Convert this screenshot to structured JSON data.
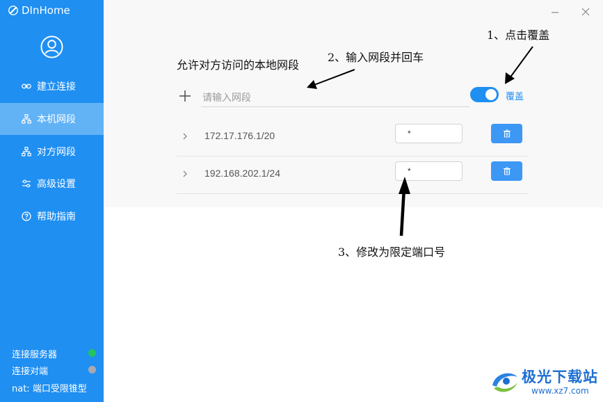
{
  "app": {
    "title": "DInHome"
  },
  "sidebar": {
    "items": [
      {
        "label": "建立连接",
        "icon": "link-icon"
      },
      {
        "label": "本机网段",
        "icon": "network-icon",
        "active": true
      },
      {
        "label": "对方网段",
        "icon": "network-icon"
      },
      {
        "label": "高级设置",
        "icon": "sliders-icon"
      },
      {
        "label": "帮助指南",
        "icon": "help-icon"
      }
    ],
    "status": [
      {
        "label": "连接服务器",
        "state_color": "#22c55e"
      },
      {
        "label": "连接对端",
        "state_color": "#a7aab3"
      },
      {
        "label": "nat: 端口受限锥型"
      }
    ]
  },
  "main": {
    "title": "允许对方访问的本地网段",
    "input_placeholder": "请输入网段",
    "input_value": "",
    "override_label": "覆盖",
    "override_on": true,
    "rows": [
      {
        "segment": "172.17.176.1/20",
        "port": "*"
      },
      {
        "segment": "192.168.202.1/24",
        "port": "*"
      }
    ]
  },
  "annotations": {
    "step1": "1、点击覆盖",
    "step2": "2、输入网段并回车",
    "step3": "3、修改为限定端口号"
  },
  "watermark": {
    "title": "极光下载站",
    "url": "www.xz7.com"
  },
  "colors": {
    "accent": "#1f8ff2",
    "sidebar_active": "#62b2f6",
    "panel_bg": "#f8f8f8"
  }
}
